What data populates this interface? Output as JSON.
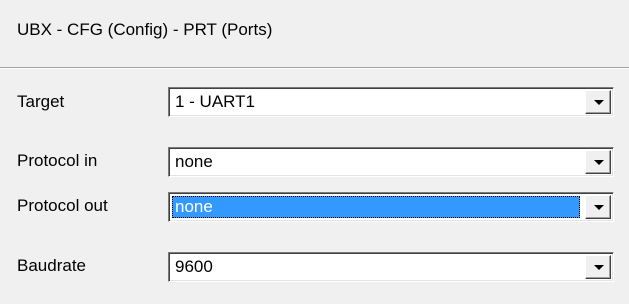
{
  "panel": {
    "title": "UBX - CFG (Config) - PRT (Ports)"
  },
  "fields": {
    "target": {
      "label": "Target",
      "value": "1 - UART1"
    },
    "protocol_in": {
      "label": "Protocol in",
      "value": "none"
    },
    "protocol_out": {
      "label": "Protocol out",
      "value": "none"
    },
    "baudrate": {
      "label": "Baudrate",
      "value": "9600"
    }
  },
  "icons": {
    "dropdown": "chevron-down-icon"
  },
  "colors": {
    "background": "#f0f0f0",
    "selection": "#3399ff",
    "field": "#ffffff"
  }
}
